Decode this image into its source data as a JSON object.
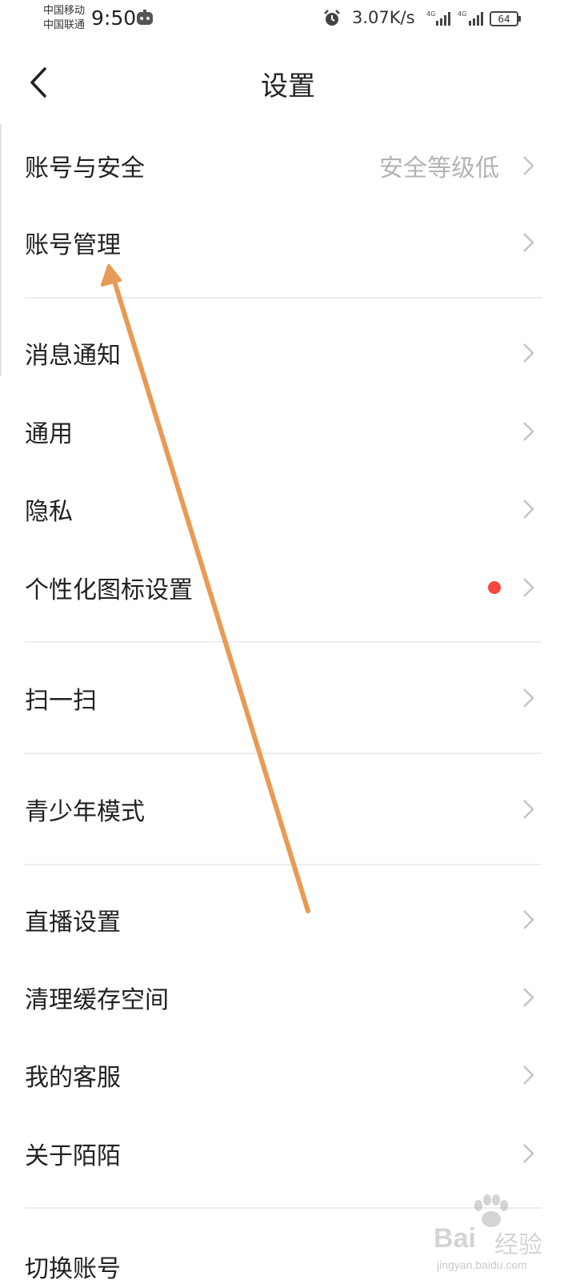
{
  "status_bar": {
    "carrier_1": "中国移动",
    "carrier_2": "中国联通",
    "time": "9:50",
    "net_speed": "3.07K/s",
    "signal_1_label": "4G",
    "signal_2_label": "4G",
    "battery": "64",
    "icons": [
      "app-notification-icon",
      "alarm-icon",
      "signal-icon",
      "battery-icon"
    ]
  },
  "header": {
    "title": "设置",
    "back_icon": "chevron-left-icon"
  },
  "settings": {
    "account_security": {
      "label": "账号与安全",
      "value": "安全等级低"
    },
    "account_management": {
      "label": "账号管理"
    },
    "notifications": {
      "label": "消息通知"
    },
    "general": {
      "label": "通用"
    },
    "privacy": {
      "label": "隐私"
    },
    "icon_personalization": {
      "label": "个性化图标设置",
      "badge": "red-dot"
    },
    "scan": {
      "label": "扫一扫"
    },
    "teen_mode": {
      "label": "青少年模式"
    },
    "live_settings": {
      "label": "直播设置"
    },
    "clear_cache": {
      "label": "清理缓存空间"
    },
    "customer_service": {
      "label": "我的客服"
    },
    "about": {
      "label": "关于陌陌"
    },
    "partial_bottom": {
      "label": "切换账号"
    }
  },
  "annotation": {
    "arrow_color": "#E99A55",
    "points_to": "账号管理"
  },
  "watermark": {
    "brand": "Bai",
    "brand_cn": "经验",
    "url": "jingyan.baidu.com"
  },
  "colors": {
    "chevron": "#c4c4c4",
    "value_text": "#b3b3b3",
    "badge": "#f5473f"
  }
}
